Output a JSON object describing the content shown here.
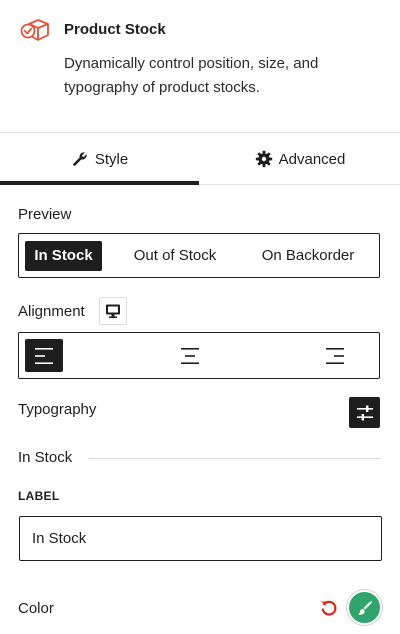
{
  "block": {
    "title": "Product Stock",
    "description": "Dynamically control position, size, and typography of product stocks.",
    "icon": "box-check-icon",
    "icon_color": "#e2523a"
  },
  "tabs": [
    {
      "label": "Style",
      "icon": "wrench-icon",
      "active": true
    },
    {
      "label": "Advanced",
      "icon": "gear-icon",
      "active": false
    }
  ],
  "preview": {
    "label": "Preview",
    "options": [
      "In Stock",
      "Out of Stock",
      "On Backorder"
    ],
    "selected": "In Stock"
  },
  "alignment": {
    "label": "Alignment",
    "device_icon": "desktop-icon",
    "options": [
      "align-left-icon",
      "align-center-icon",
      "align-right-icon"
    ],
    "selected": "align-left-icon"
  },
  "typography": {
    "label": "Typography",
    "icon": "sliders-icon"
  },
  "section": {
    "title": "In Stock"
  },
  "label_field": {
    "caption": "LABEL",
    "value": "In Stock"
  },
  "color": {
    "label": "Color",
    "reset_icon": "reset-icon",
    "reset_color": "#d9261c",
    "swatch_color": "#30a46c"
  },
  "colors": {
    "accent": "#1e1e1e",
    "border": "#e0e0e0"
  }
}
